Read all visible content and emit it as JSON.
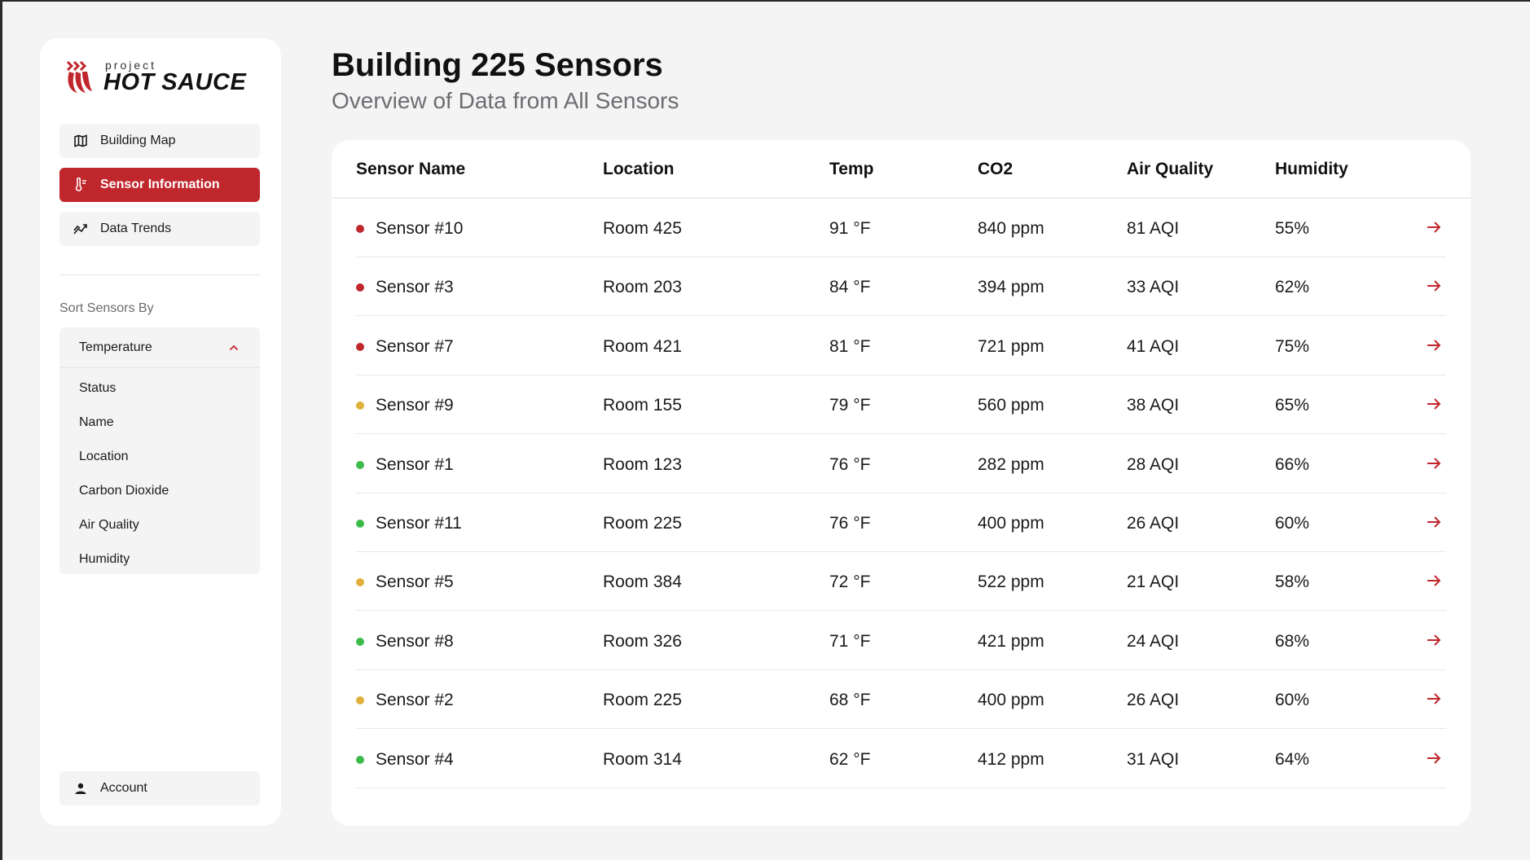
{
  "brand": {
    "small": "project",
    "name": "HOT SAUCE",
    "color": "#c0272d"
  },
  "nav": [
    {
      "label": "Building Map",
      "icon": "map-icon",
      "active": false
    },
    {
      "label": "Sensor Information",
      "icon": "thermometer-icon",
      "active": true
    },
    {
      "label": "Data Trends",
      "icon": "trend-chart-icon",
      "active": false
    }
  ],
  "sort": {
    "label": "Sort Sensors By",
    "selected": "Temperature",
    "options": [
      "Status",
      "Name",
      "Location",
      "Carbon Dioxide",
      "Air Quality",
      "Humidity"
    ]
  },
  "account": {
    "label": "Account",
    "icon": "user-icon"
  },
  "header": {
    "title": "Building 225 Sensors",
    "subtitle": "Overview of Data from All Sensors"
  },
  "status_colors": {
    "red": "#c0272d",
    "yellow": "#e0b03a",
    "green": "#3dbb4a"
  },
  "table": {
    "columns": [
      "Sensor Name",
      "Location",
      "Temp",
      "CO2",
      "Air Quality",
      "Humidity"
    ],
    "rows": [
      {
        "status": "red",
        "name": "Sensor #10",
        "location": "Room 425",
        "temp": "91 °F",
        "co2": "840 ppm",
        "aq": "81 AQI",
        "humidity": "55%"
      },
      {
        "status": "red",
        "name": "Sensor #3",
        "location": "Room 203",
        "temp": "84 °F",
        "co2": "394 ppm",
        "aq": "33 AQI",
        "humidity": "62%"
      },
      {
        "status": "red",
        "name": "Sensor #7",
        "location": "Room 421",
        "temp": "81 °F",
        "co2": "721 ppm",
        "aq": "41 AQI",
        "humidity": "75%"
      },
      {
        "status": "yellow",
        "name": "Sensor #9",
        "location": "Room 155",
        "temp": "79 °F",
        "co2": "560 ppm",
        "aq": "38 AQI",
        "humidity": "65%"
      },
      {
        "status": "green",
        "name": "Sensor #1",
        "location": "Room 123",
        "temp": "76 °F",
        "co2": "282 ppm",
        "aq": "28 AQI",
        "humidity": "66%"
      },
      {
        "status": "green",
        "name": "Sensor #11",
        "location": "Room 225",
        "temp": "76 °F",
        "co2": "400 ppm",
        "aq": "26 AQI",
        "humidity": "60%"
      },
      {
        "status": "yellow",
        "name": "Sensor #5",
        "location": "Room 384",
        "temp": "72 °F",
        "co2": "522 ppm",
        "aq": "21 AQI",
        "humidity": "58%"
      },
      {
        "status": "green",
        "name": "Sensor #8",
        "location": "Room 326",
        "temp": "71 °F",
        "co2": "421 ppm",
        "aq": "24 AQI",
        "humidity": "68%"
      },
      {
        "status": "yellow",
        "name": "Sensor #2",
        "location": "Room 225",
        "temp": "68 °F",
        "co2": "400 ppm",
        "aq": "26 AQI",
        "humidity": "60%"
      },
      {
        "status": "green",
        "name": "Sensor #4",
        "location": "Room 314",
        "temp": "62 °F",
        "co2": "412 ppm",
        "aq": "31 AQI",
        "humidity": "64%"
      }
    ]
  }
}
